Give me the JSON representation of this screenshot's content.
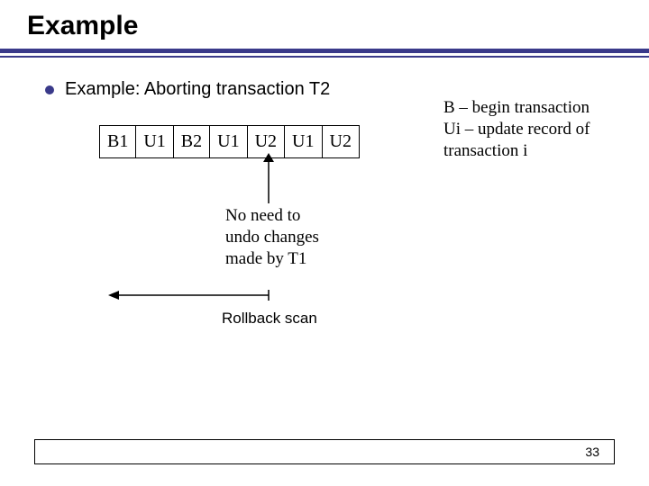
{
  "title": "Example",
  "bullet": "Example: Aborting transaction T2",
  "log": [
    "B1",
    "U1",
    "B2",
    "U1",
    "U2",
    "U1",
    "U2"
  ],
  "legend": {
    "line1": "B – begin transaction",
    "line2": "Ui – update record of",
    "line3": "transaction i"
  },
  "note": {
    "line1": "No need to",
    "line2": "undo changes",
    "line3": "made by T1"
  },
  "rollback_label": "Rollback scan",
  "slide_number": "33"
}
